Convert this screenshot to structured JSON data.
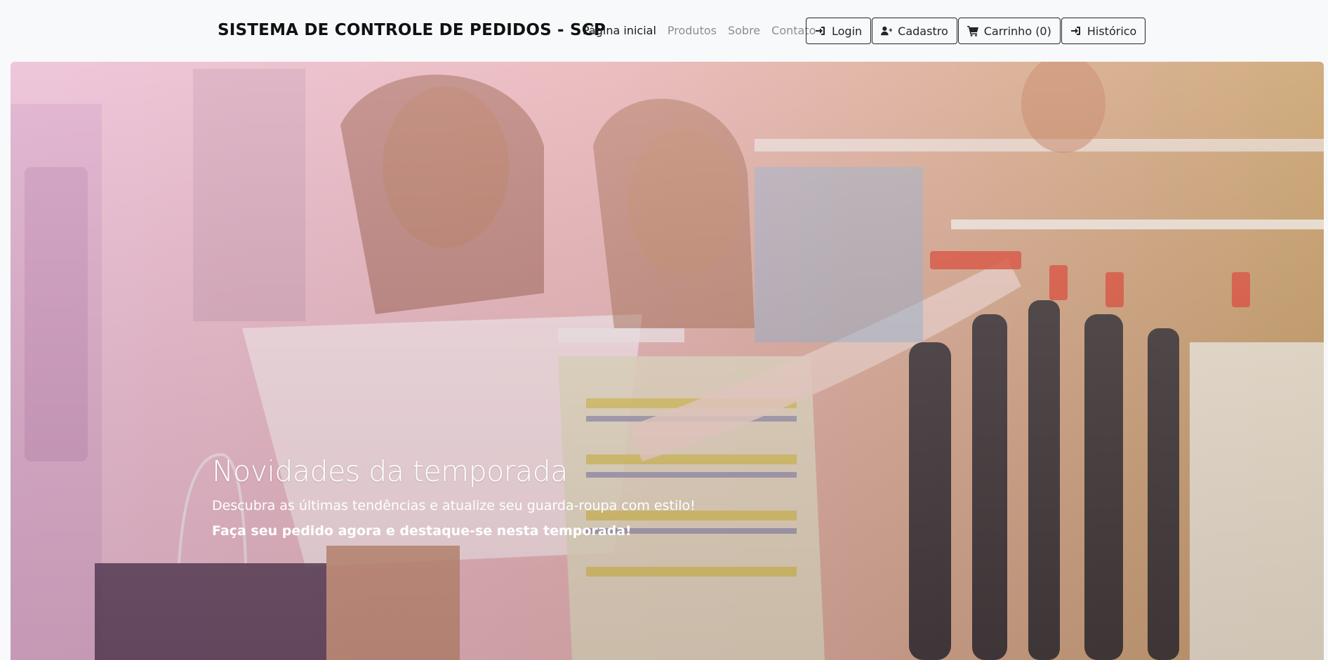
{
  "brand": "SISTEMA DE CONTROLE DE PEDIDOS - SCP",
  "nav": {
    "links": [
      "Página inicial",
      "Produtos",
      "Sobre",
      "Contato"
    ],
    "active_link": "Página inicial"
  },
  "buttons": {
    "login": {
      "label": "Login",
      "icon": "sign-in-icon"
    },
    "cadastro": {
      "label": "Cadastro",
      "icon": "user-plus-icon"
    },
    "carrinho": {
      "label": "Carrinho (0)",
      "icon": "shopping-cart-icon"
    },
    "historico": {
      "label": "Histórico",
      "icon": "sign-in-icon"
    }
  },
  "hero": {
    "title": "Novidades da temporada",
    "subtitle": "Descubra as últimas tendências e atualize seu guarda-roupa com estilo!",
    "cta": "Faça seu pedido agora e destaque-se nesta temporada!"
  },
  "colors": {
    "navbar_bg": "#f8f9fa",
    "brand_text": "#111111",
    "link_muted": "#8a8f94",
    "overlay_left": "#e9b3cf",
    "overlay_right": "#c9a06a"
  }
}
